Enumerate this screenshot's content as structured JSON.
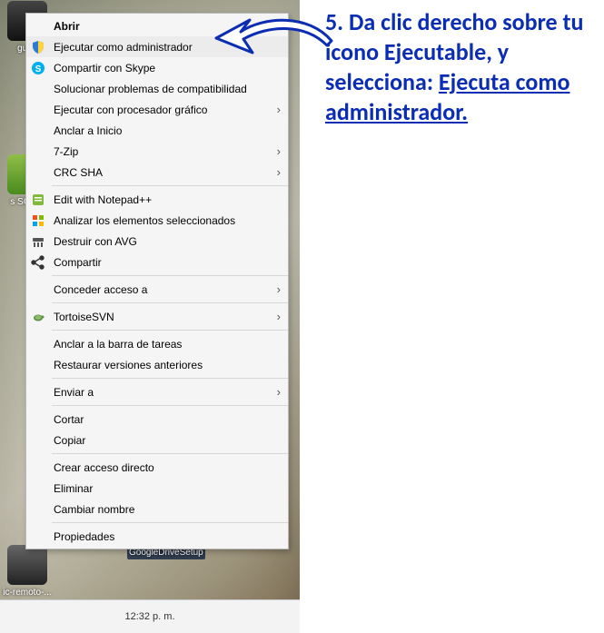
{
  "desktop": {
    "icons": {
      "i1_label": "gutty",
      "i2_label": "s SGA...",
      "i3_label": "ic-remoto-...",
      "i4_label": "GoogleDriveSetup"
    },
    "taskbar": {
      "clock": "12:32 p. m."
    }
  },
  "menu": {
    "abrir": "Abrir",
    "ejecutar_admin": "Ejecutar como administrador",
    "skype": "Compartir con Skype",
    "compat": "Solucionar problemas de compatibilidad",
    "gpu": "Ejecutar con procesador gráfico",
    "anclar_inicio": "Anclar a Inicio",
    "sevenzip": "7-Zip",
    "crc": "CRC SHA",
    "notepad": "Edit with Notepad++",
    "analizar": "Analizar los elementos seleccionados",
    "destruir": "Destruir con AVG",
    "compartir": "Compartir",
    "conceder": "Conceder acceso a",
    "tortoise": "TortoiseSVN",
    "anclar_tareas": "Anclar a la barra de tareas",
    "restaurar": "Restaurar versiones anteriores",
    "enviar": "Enviar a",
    "cortar": "Cortar",
    "copiar": "Copiar",
    "acceso_directo": "Crear acceso directo",
    "eliminar": "Eliminar",
    "renombrar": "Cambiar nombre",
    "propiedades": "Propiedades"
  },
  "note": {
    "prefix": "5. Da clic derecho sobre tu icono Ejecutable, y selecciona: ",
    "link": "Ejecuta como administrador."
  }
}
